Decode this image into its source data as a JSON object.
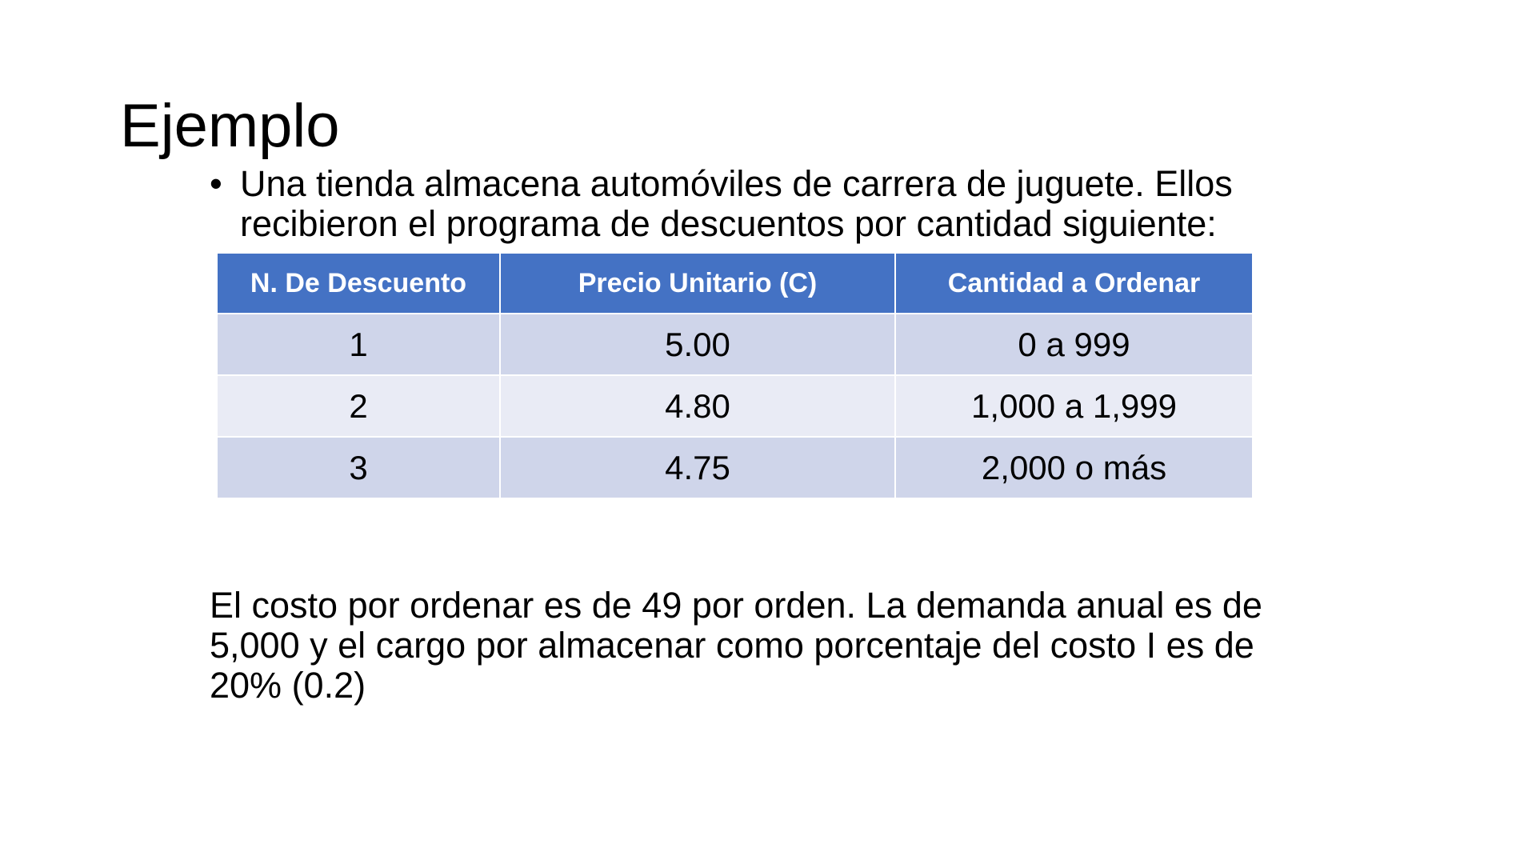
{
  "slide": {
    "title": "Ejemplo",
    "bullet": {
      "marker": "•",
      "text": "Una tienda almacena automóviles de carrera de juguete. Ellos recibieron el programa de descuentos por cantidad siguiente:"
    },
    "table": {
      "headers": [
        "N. De Descuento",
        "Precio Unitario (C)",
        "Cantidad a Ordenar"
      ],
      "rows": [
        [
          "1",
          "5.00",
          "0 a 999"
        ],
        [
          "2",
          "4.80",
          "1,000 a 1,999"
        ],
        [
          "3",
          "4.75",
          "2,000 o más"
        ]
      ],
      "colors": {
        "header_bg": "#4472c4",
        "header_text": "#ffffff",
        "row_odd_bg": "#cfd5ea",
        "row_even_bg": "#e9ebf5"
      }
    },
    "paragraph": "El costo por ordenar es de 49 por orden.  La demanda anual es de 5,000 y el cargo por almacenar como porcentaje del costo I es de 20% (0.2)"
  }
}
